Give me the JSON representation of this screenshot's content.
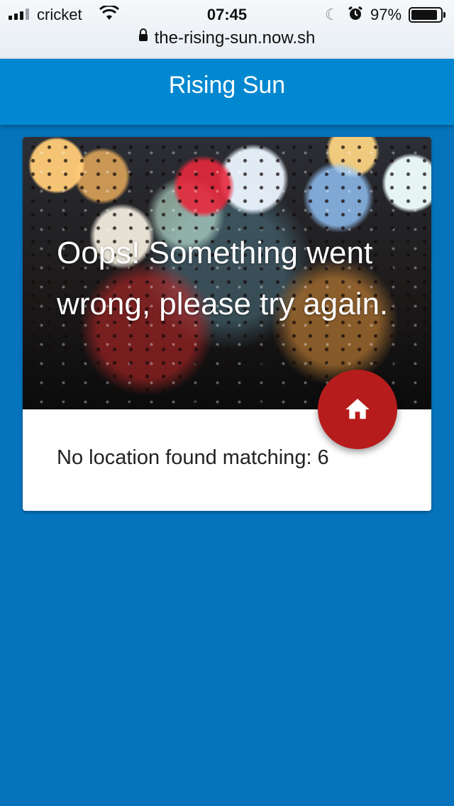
{
  "status_bar": {
    "carrier": "cricket",
    "time": "07:45",
    "battery_percent": "97%",
    "icons": [
      "signal-icon",
      "wifi-icon",
      "moon-icon",
      "alarm-icon",
      "battery-icon"
    ]
  },
  "browser": {
    "url": "the-rising-sun.now.sh"
  },
  "app": {
    "title": "Rising Sun"
  },
  "card": {
    "error_title": "Oops! Something went wrong, please try again.",
    "message": "No location found matching: 6",
    "fab_icon": "home-icon"
  },
  "colors": {
    "page_background": "#0574bd",
    "app_bar": "#0288d1",
    "fab": "#b71c1c"
  }
}
